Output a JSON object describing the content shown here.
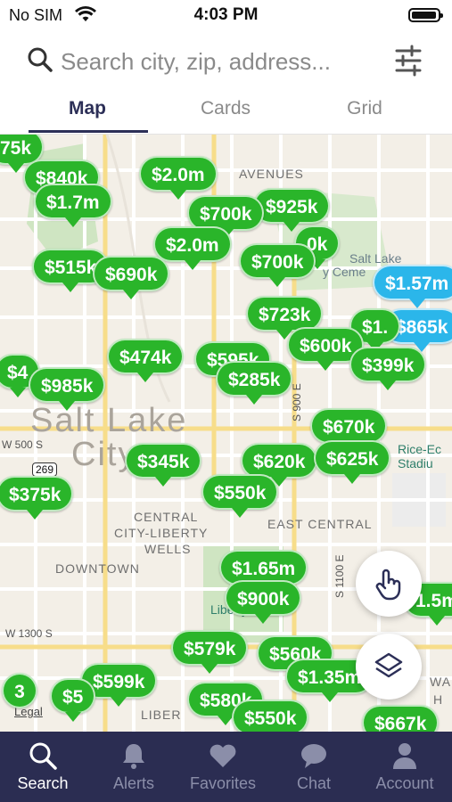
{
  "status": {
    "carrier": "No SIM",
    "time": "4:03 PM"
  },
  "search": {
    "placeholder": "Search city, zip, address..."
  },
  "tabs": [
    {
      "label": "Map",
      "active": true
    },
    {
      "label": "Cards",
      "active": false
    },
    {
      "label": "Grid",
      "active": false
    }
  ],
  "map": {
    "labels": {
      "city1": "Salt Lake",
      "city2": "City",
      "central1": "CENTRAL",
      "central2": "CITY-LIBERTY",
      "central3": "WELLS",
      "downtown": "DOWNTOWN",
      "east_central": "EAST CENTRAL",
      "w500s": "W 500 S",
      "w1300s": "W 1300 S",
      "s1100e": "S 1100 E",
      "s900e": "S 900 E",
      "avenues": "AVENUES",
      "salt_lake_cem1": "Salt Lake",
      "salt_lake_cem2": "y Ceme",
      "rice_eccles1": "Rice-Ec",
      "rice_eccles2": "Stadiu",
      "liberty_park": "Liberty Park",
      "liber": "LIBER",
      "wa": "WA",
      "h": "H",
      "route": "269",
      "legal": "Legal"
    },
    "pins": [
      {
        "id": "p75k",
        "label": "75k",
        "color": "green"
      },
      {
        "id": "p840k",
        "label": "$840k",
        "color": "green"
      },
      {
        "id": "p2m",
        "label": "$2.0m",
        "color": "green"
      },
      {
        "id": "p1_7m",
        "label": "$1.7m",
        "color": "green"
      },
      {
        "id": "p925k",
        "label": "$925k",
        "color": "green"
      },
      {
        "id": "p700k_a",
        "label": "$700k",
        "color": "green"
      },
      {
        "id": "p2m_b",
        "label": "$2.0m",
        "color": "green"
      },
      {
        "id": "p0k",
        "label": "0k",
        "color": "green"
      },
      {
        "id": "p515k",
        "label": "$515k",
        "color": "green"
      },
      {
        "id": "p690k",
        "label": "$690k",
        "color": "green"
      },
      {
        "id": "p700k_b",
        "label": "$700k",
        "color": "green"
      },
      {
        "id": "p1_57m",
        "label": "$1.57m",
        "color": "blue"
      },
      {
        "id": "p723k",
        "label": "$723k",
        "color": "green"
      },
      {
        "id": "p865k",
        "label": "$865k",
        "color": "blue"
      },
      {
        "id": "p1x",
        "label": "$1.",
        "color": "green"
      },
      {
        "id": "p600k",
        "label": "$600k",
        "color": "green"
      },
      {
        "id": "p474k",
        "label": "$474k",
        "color": "green"
      },
      {
        "id": "p595k",
        "label": "$595k",
        "color": "green"
      },
      {
        "id": "p399k",
        "label": "$399k",
        "color": "green"
      },
      {
        "id": "p4x",
        "label": "$4",
        "color": "green"
      },
      {
        "id": "p985k",
        "label": "$985k",
        "color": "green"
      },
      {
        "id": "p285k",
        "label": "$285k",
        "color": "green"
      },
      {
        "id": "p670k",
        "label": "$670k",
        "color": "green"
      },
      {
        "id": "p345k",
        "label": "$345k",
        "color": "green"
      },
      {
        "id": "p620k",
        "label": "$620k",
        "color": "green"
      },
      {
        "id": "p625k",
        "label": "$625k",
        "color": "green"
      },
      {
        "id": "p375k",
        "label": "$375k",
        "color": "green"
      },
      {
        "id": "p550k_a",
        "label": "$550k",
        "color": "green"
      },
      {
        "id": "p1_65m",
        "label": "$1.65m",
        "color": "green"
      },
      {
        "id": "p900k",
        "label": "$900k",
        "color": "green"
      },
      {
        "id": "p1_5m",
        "label": "1.5m",
        "color": "green"
      },
      {
        "id": "p579k",
        "label": "$579k",
        "color": "green"
      },
      {
        "id": "p560k",
        "label": "$560k",
        "color": "green"
      },
      {
        "id": "p1_35m",
        "label": "$1.35m",
        "color": "green"
      },
      {
        "id": "p599k",
        "label": "$599k",
        "color": "green"
      },
      {
        "id": "p5x",
        "label": "$5",
        "color": "green"
      },
      {
        "id": "p580k",
        "label": "$580k",
        "color": "green"
      },
      {
        "id": "p550k_b",
        "label": "$550k",
        "color": "green"
      },
      {
        "id": "p667k",
        "label": "$667k",
        "color": "green"
      },
      {
        "id": "pcount3",
        "label": "3",
        "color": "green"
      }
    ]
  },
  "nav": [
    {
      "label": "Search",
      "icon": "search-icon",
      "active": true
    },
    {
      "label": "Alerts",
      "icon": "bell-icon",
      "active": false
    },
    {
      "label": "Favorites",
      "icon": "heart-icon",
      "active": false
    },
    {
      "label": "Chat",
      "icon": "chat-icon",
      "active": false
    },
    {
      "label": "Account",
      "icon": "person-icon",
      "active": false
    }
  ],
  "colors": {
    "pin_green": "#2ab52a",
    "pin_blue": "#2bb6ea",
    "nav_bg": "#2b2d52",
    "tab_active": "#2c2f57"
  }
}
